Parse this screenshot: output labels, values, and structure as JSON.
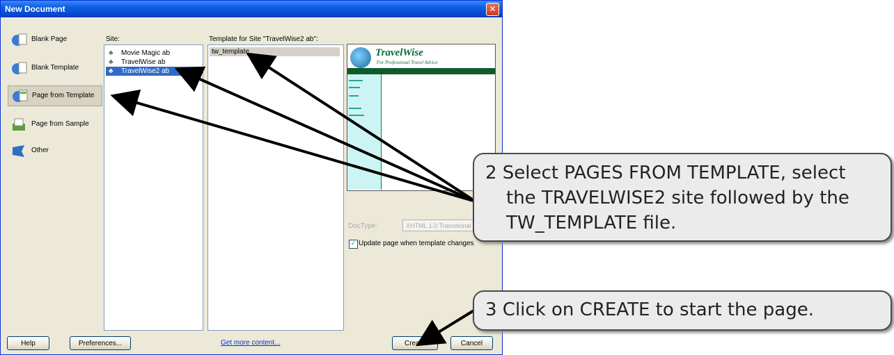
{
  "dialog": {
    "title": "New Document",
    "close_glyph": "✕"
  },
  "categories": [
    {
      "label": "Blank Page",
      "icon": "blank-page-icon",
      "selected": false
    },
    {
      "label": "Blank Template",
      "icon": "blank-template-icon",
      "selected": false
    },
    {
      "label": "Page from Template",
      "icon": "page-from-template-icon",
      "selected": true
    },
    {
      "label": "Page from Sample",
      "icon": "page-from-sample-icon",
      "selected": false
    },
    {
      "label": "Other",
      "icon": "other-icon",
      "selected": false
    }
  ],
  "site": {
    "label": "Site:",
    "items": [
      {
        "label": "Movie Magic ab",
        "selected": false
      },
      {
        "label": "TravelWise ab",
        "selected": false
      },
      {
        "label": "TravelWise2 ab",
        "selected": true
      }
    ]
  },
  "template": {
    "label": "Template for Site \"TravelWise2 ab\":",
    "items": [
      {
        "label": "tw_template",
        "selected": true
      }
    ]
  },
  "preview": {
    "brand": "TravelWise",
    "tagline": "For Professional Travel Advice"
  },
  "doctype": {
    "label": "DocType:",
    "value": "XHTML 1.0 Transitional"
  },
  "update_option": {
    "label": "Update page when template changes",
    "checked": true
  },
  "footer": {
    "help": "Help",
    "preferences": "Preferences...",
    "more_content": "Get more content...",
    "create": "Create",
    "cancel": "Cancel"
  },
  "callouts": {
    "step2": {
      "line1": "2  Select PAGES FROM TEMPLATE, select",
      "line2": "the TRAVELWISE2 site followed by the",
      "line3": "TW_TEMPLATE file."
    },
    "step3": {
      "line1": "3  Click on CREATE to start the page."
    }
  },
  "colors": {
    "titlebar": "#0a5ee0",
    "selection": "#316ac5",
    "callout_bg": "#ebebeb"
  }
}
